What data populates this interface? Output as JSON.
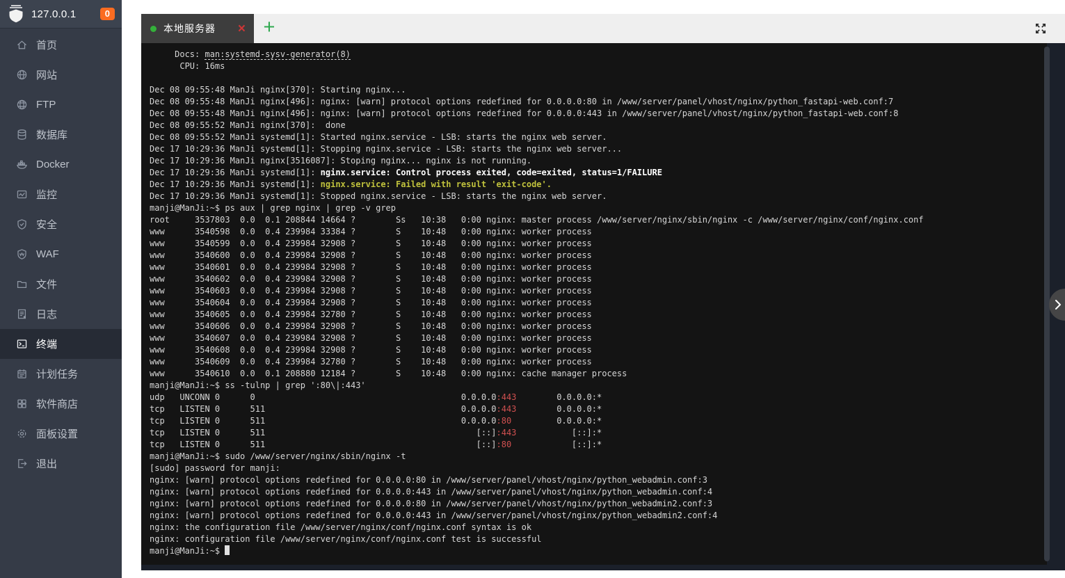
{
  "colors": {
    "sidebar_bg": "#353b47",
    "sidebar_active_bg": "#262b35",
    "badge_orange": "#fb6c21",
    "tab_bg": "#3d3d3d",
    "tab_dot_green": "#34b13a",
    "tab_close_red": "#cd3636",
    "add_button_green": "#2fa84f",
    "terminal_bg": "#141414",
    "terminal_text": "#d6d6d6",
    "terminal_red": "#d05050",
    "terminal_yellow": "#c0c23c"
  },
  "sidebar": {
    "header": {
      "logo_icon": "shield-logo-icon",
      "address": "127.0.0.1",
      "badge": "0"
    },
    "items": [
      {
        "key": "home",
        "icon": "home-icon",
        "label": "首页",
        "active": false
      },
      {
        "key": "sites",
        "icon": "globe-icon",
        "label": "网站",
        "active": false
      },
      {
        "key": "ftp",
        "icon": "ftp-globe-icon",
        "label": "FTP",
        "active": false
      },
      {
        "key": "database",
        "icon": "database-icon",
        "label": "数据库",
        "active": false
      },
      {
        "key": "docker",
        "icon": "docker-icon",
        "label": "Docker",
        "active": false
      },
      {
        "key": "monitor",
        "icon": "monitor-icon",
        "label": "监控",
        "active": false
      },
      {
        "key": "security",
        "icon": "shield-check-icon",
        "label": "安全",
        "active": false
      },
      {
        "key": "waf",
        "icon": "waf-shield-icon",
        "label": "WAF",
        "active": false
      },
      {
        "key": "files",
        "icon": "folder-icon",
        "label": "文件",
        "active": false
      },
      {
        "key": "logs",
        "icon": "log-file-icon",
        "label": "日志",
        "active": false
      },
      {
        "key": "terminal",
        "icon": "terminal-icon",
        "label": "终端",
        "active": true
      },
      {
        "key": "cron",
        "icon": "calendar-icon",
        "label": "计划任务",
        "active": false
      },
      {
        "key": "appstore",
        "icon": "app-grid-icon",
        "label": "软件商店",
        "active": false
      },
      {
        "key": "panel-settings",
        "icon": "gear-icon",
        "label": "面板设置",
        "active": false
      },
      {
        "key": "logout",
        "icon": "logout-icon",
        "label": "退出",
        "active": false
      }
    ]
  },
  "terminal_panel": {
    "tab": {
      "status_dot_icon": "green-dot-icon",
      "title": "本地服务器",
      "close_label": "×"
    },
    "add_button_label": "+",
    "fullscreen_icon": "fullscreen-icon",
    "collapse_icon": "chevron-right-icon",
    "terminal": {
      "lines": [
        [
          {
            "c": "",
            "t": "     Docs: "
          },
          {
            "c": "u",
            "t": "man:systemd-sysv-generator(8)"
          }
        ],
        [
          {
            "c": "",
            "t": "      CPU: 16ms"
          }
        ],
        [],
        [
          {
            "c": "",
            "t": "Dec 08 09:55:48 ManJi nginx[370]: Starting nginx..."
          }
        ],
        [
          {
            "c": "",
            "t": "Dec 08 09:55:48 ManJi nginx[496]: nginx: [warn] protocol options redefined for 0.0.0.0:80 in /www/server/panel/vhost/nginx/python_fastapi-web.conf:7"
          }
        ],
        [
          {
            "c": "",
            "t": "Dec 08 09:55:48 ManJi nginx[496]: nginx: [warn] protocol options redefined for 0.0.0.0:443 in /www/server/panel/vhost/nginx/python_fastapi-web.conf:8"
          }
        ],
        [
          {
            "c": "",
            "t": "Dec 08 09:55:52 ManJi nginx[370]:  done"
          }
        ],
        [
          {
            "c": "",
            "t": "Dec 08 09:55:52 ManJi systemd[1]: Started nginx.service - LSB: starts the nginx web server."
          }
        ],
        [
          {
            "c": "",
            "t": "Dec 17 10:29:36 ManJi systemd[1]: Stopping nginx.service - LSB: starts the nginx web server..."
          }
        ],
        [
          {
            "c": "",
            "t": "Dec 17 10:29:36 ManJi nginx[3516087]: Stoping nginx... nginx is not running."
          }
        ],
        [
          {
            "c": "",
            "t": "Dec 17 10:29:36 ManJi systemd[1]: "
          },
          {
            "c": "b",
            "t": "nginx.service: Control process exited, code=exited, status=1/FAILURE"
          }
        ],
        [
          {
            "c": "",
            "t": "Dec 17 10:29:36 ManJi systemd[1]: "
          },
          {
            "c": "y",
            "t": "nginx.service: Failed with result 'exit-code'."
          }
        ],
        [
          {
            "c": "",
            "t": "Dec 17 10:29:36 ManJi systemd[1]: Stopped nginx.service - LSB: starts the nginx web server."
          }
        ],
        [
          {
            "c": "",
            "t": "manji@ManJi:~$ ps aux | grep nginx | grep -v grep"
          }
        ],
        [
          {
            "c": "",
            "t": "root     3537803  0.0  0.1 208844 14664 ?        Ss   10:38   0:00 nginx: master process /www/server/nginx/sbin/nginx -c /www/server/nginx/conf/nginx.conf"
          }
        ],
        [
          {
            "c": "",
            "t": "www      3540598  0.0  0.4 239984 33384 ?        S    10:48   0:00 nginx: worker process"
          }
        ],
        [
          {
            "c": "",
            "t": "www      3540599  0.0  0.4 239984 32908 ?        S    10:48   0:00 nginx: worker process"
          }
        ],
        [
          {
            "c": "",
            "t": "www      3540600  0.0  0.4 239984 32908 ?        S    10:48   0:00 nginx: worker process"
          }
        ],
        [
          {
            "c": "",
            "t": "www      3540601  0.0  0.4 239984 32908 ?        S    10:48   0:00 nginx: worker process"
          }
        ],
        [
          {
            "c": "",
            "t": "www      3540602  0.0  0.4 239984 32908 ?        S    10:48   0:00 nginx: worker process"
          }
        ],
        [
          {
            "c": "",
            "t": "www      3540603  0.0  0.4 239984 32908 ?        S    10:48   0:00 nginx: worker process"
          }
        ],
        [
          {
            "c": "",
            "t": "www      3540604  0.0  0.4 239984 32908 ?        S    10:48   0:00 nginx: worker process"
          }
        ],
        [
          {
            "c": "",
            "t": "www      3540605  0.0  0.4 239984 32780 ?        S    10:48   0:00 nginx: worker process"
          }
        ],
        [
          {
            "c": "",
            "t": "www      3540606  0.0  0.4 239984 32908 ?        S    10:48   0:00 nginx: worker process"
          }
        ],
        [
          {
            "c": "",
            "t": "www      3540607  0.0  0.4 239984 32908 ?        S    10:48   0:00 nginx: worker process"
          }
        ],
        [
          {
            "c": "",
            "t": "www      3540608  0.0  0.4 239984 32908 ?        S    10:48   0:00 nginx: worker process"
          }
        ],
        [
          {
            "c": "",
            "t": "www      3540609  0.0  0.4 239984 32780 ?        S    10:48   0:00 nginx: worker process"
          }
        ],
        [
          {
            "c": "",
            "t": "www      3540610  0.0  0.1 208880 12184 ?        S    10:48   0:00 nginx: cache manager process"
          }
        ],
        [
          {
            "c": "",
            "t": "manji@ManJi:~$ ss -tulnp | grep ':80\\|:443'"
          }
        ],
        [
          {
            "c": "",
            "t": "udp   UNCONN 0      0                                         0.0.0.0"
          },
          {
            "c": "r",
            "t": ":443"
          },
          {
            "c": "",
            "t": "        0.0.0.0:*"
          }
        ],
        [
          {
            "c": "",
            "t": "tcp   LISTEN 0      511                                       0.0.0.0"
          },
          {
            "c": "r",
            "t": ":443"
          },
          {
            "c": "",
            "t": "        0.0.0.0:*"
          }
        ],
        [
          {
            "c": "",
            "t": "tcp   LISTEN 0      511                                       0.0.0.0"
          },
          {
            "c": "r",
            "t": ":80"
          },
          {
            "c": "",
            "t": "         0.0.0.0:*"
          }
        ],
        [
          {
            "c": "",
            "t": "tcp   LISTEN 0      511                                          [::]"
          },
          {
            "c": "r",
            "t": ":443"
          },
          {
            "c": "",
            "t": "           [::]:*"
          }
        ],
        [
          {
            "c": "",
            "t": "tcp   LISTEN 0      511                                          [::]"
          },
          {
            "c": "r",
            "t": ":80"
          },
          {
            "c": "",
            "t": "            [::]:*"
          }
        ],
        [
          {
            "c": "",
            "t": "manji@ManJi:~$ sudo /www/server/nginx/sbin/nginx -t"
          }
        ],
        [
          {
            "c": "",
            "t": "[sudo] password for manji: "
          }
        ],
        [
          {
            "c": "",
            "t": "nginx: [warn] protocol options redefined for 0.0.0.0:80 in /www/server/panel/vhost/nginx/python_webadmin.conf:3"
          }
        ],
        [
          {
            "c": "",
            "t": "nginx: [warn] protocol options redefined for 0.0.0.0:443 in /www/server/panel/vhost/nginx/python_webadmin.conf:4"
          }
        ],
        [
          {
            "c": "",
            "t": "nginx: [warn] protocol options redefined for 0.0.0.0:80 in /www/server/panel/vhost/nginx/python_webadmin2.conf:3"
          }
        ],
        [
          {
            "c": "",
            "t": "nginx: [warn] protocol options redefined for 0.0.0.0:443 in /www/server/panel/vhost/nginx/python_webadmin2.conf:4"
          }
        ],
        [
          {
            "c": "",
            "t": "nginx: the configuration file /www/server/nginx/conf/nginx.conf syntax is ok"
          }
        ],
        [
          {
            "c": "",
            "t": "nginx: configuration file /www/server/nginx/conf/nginx.conf test is successful"
          }
        ],
        [
          {
            "c": "",
            "t": "manji@ManJi:~$ "
          },
          {
            "c": "cur",
            "t": ""
          }
        ]
      ]
    }
  }
}
